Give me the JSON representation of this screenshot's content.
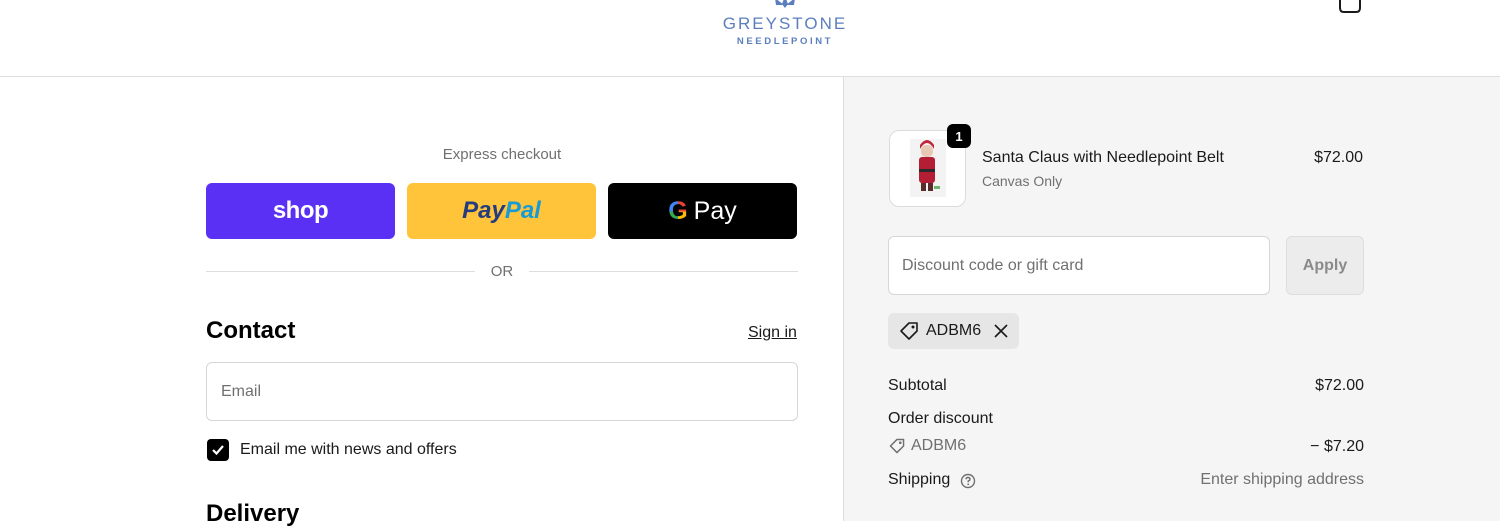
{
  "header": {
    "brand_name": "GREYSTONE",
    "brand_sub": "NEEDLEPOINT",
    "brand_color": "#5b7fbe",
    "cart_icon": "shopping-bag-icon"
  },
  "express": {
    "label": "Express checkout",
    "shop_label": "shop",
    "paypal_label_1": "Pay",
    "paypal_label_2": "Pal",
    "gpay_g": "G",
    "gpay_label": "Pay",
    "or_label": "OR"
  },
  "contact": {
    "title": "Contact",
    "sign_in": "Sign in",
    "email_placeholder": "Email",
    "news_checkbox_label": "Email me with news and offers",
    "news_checked": true
  },
  "delivery": {
    "title": "Delivery"
  },
  "order": {
    "item": {
      "quantity": "1",
      "name": "Santa Claus with Needlepoint Belt",
      "variant": "Canvas Only",
      "price": "$72.00"
    },
    "discount_placeholder": "Discount code or gift card",
    "apply_label": "Apply",
    "applied_code": "ADBM6",
    "subtotal_label": "Subtotal",
    "subtotal_value": "$72.00",
    "order_discount_label": "Order discount",
    "discount_code": "ADBM6",
    "discount_value": "− $7.20",
    "shipping_label": "Shipping",
    "shipping_value": "Enter shipping address"
  },
  "colors": {
    "shop_purple": "#5a31f4",
    "paypal_yellow": "#ffc439",
    "gpay_black": "#000000",
    "summary_bg": "#f5f5f5"
  }
}
